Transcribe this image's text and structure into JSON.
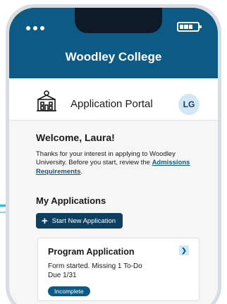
{
  "app": {
    "title": "Woodley College"
  },
  "portal": {
    "title": "Application Portal",
    "avatar_initials": "LG"
  },
  "welcome": {
    "heading": "Welcome, Laura!",
    "text_before": "Thanks for your interest in applying to Woodley University. Before you start, review the ",
    "link": "Admissions Requirements",
    "text_after": "."
  },
  "applications": {
    "heading": "My Applications",
    "start_button": "Start New Application",
    "items": [
      {
        "title": "Program Application",
        "status_line1": "Form started. Missing 1 To-Do",
        "status_line2": "Due 1/31",
        "badge": "Incomplete"
      }
    ]
  },
  "colors": {
    "brand": "#0d5a85",
    "button": "#0f3f60",
    "avatar_bg": "#d2e8f4",
    "accent": "#2fb8d8"
  }
}
